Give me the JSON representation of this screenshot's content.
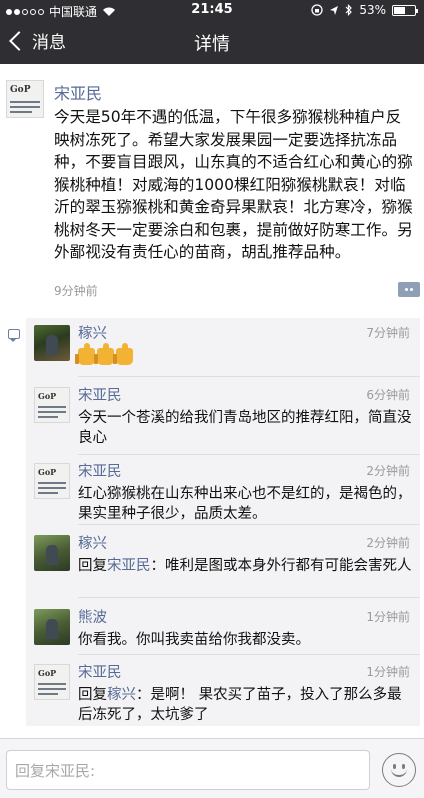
{
  "status": {
    "carrier": "中国联通",
    "time": "21:45",
    "battery": "53%",
    "battery_level": 0.53
  },
  "nav": {
    "back_label": "消息",
    "title": "详情"
  },
  "post": {
    "author": "宋亚民",
    "avatar_text": "GoP",
    "text": "今天是50年不遇的低温，下午很多猕猴桃种植户反映树冻死了。希望大家发展果园一定要选择抗冻品种，不要盲目跟风，山东真的不适合红心和黄心的猕猴桃种植！对威海的1000棵红阳猕猴桃默哀！对临沂的翠玉猕猴桃和黄金奇异果默哀！北方寒冷，猕猴桃树冬天一定要涂白和包裹，提前做好防寒工作。另外鄙视没有责任心的苗商，胡乱推荐品种。",
    "time": "9分钟前"
  },
  "comments": [
    {
      "name": "稼兴",
      "time": "7分钟前",
      "text": "",
      "reply_to": ""
    },
    {
      "name": "宋亚民",
      "time": "6分钟前",
      "text": "今天一个苍溪的给我们青岛地区的推荐红阳，简直没良心",
      "reply_to": ""
    },
    {
      "name": "宋亚民",
      "time": "2分钟前",
      "text": "红心猕猴桃在山东种出来心也不是红的，是褐色的，果实里种子很少，品质太差。",
      "reply_to": ""
    },
    {
      "name": "稼兴",
      "time": "2分钟前",
      "text": "：唯利是图或本身外行都有可能会害死人",
      "reply_prefix": "回复",
      "reply_to": "宋亚民"
    },
    {
      "name": "熊波",
      "time": "1分钟前",
      "text": "你看我。你叫我卖苗给你我都没卖。",
      "reply_to": ""
    },
    {
      "name": "宋亚民",
      "time": "1分钟前",
      "text": "：是啊！ 果农买了苗子，投入了那么多最后冻死了，太坑爹了",
      "reply_prefix": "回复",
      "reply_to": "稼兴"
    }
  ],
  "input": {
    "placeholder": "回复宋亚民:"
  }
}
